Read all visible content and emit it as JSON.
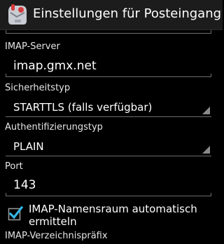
{
  "action_bar": {
    "title": "Einstellungen für Posteingangs…",
    "icon": "app-mail-icon"
  },
  "form": {
    "imap_server": {
      "label": "IMAP-Server",
      "value": "imap.gmx.net"
    },
    "security_type": {
      "label": "Sicherheitstyp",
      "value": "STARTTLS (falls verfügbar)"
    },
    "auth_type": {
      "label": "Authentifizierungstyp",
      "value": "PLAIN"
    },
    "port": {
      "label": "Port",
      "value": "143"
    },
    "auto_namespace": {
      "label": "IMAP-Namensraum automatisch ermitteln",
      "checked": true
    },
    "path_prefix": {
      "label": "IMAP-Verzeichnispräfix"
    }
  },
  "colors": {
    "accent": "#33b5e5",
    "background": "#000000",
    "divider": "#6d6d6d"
  }
}
